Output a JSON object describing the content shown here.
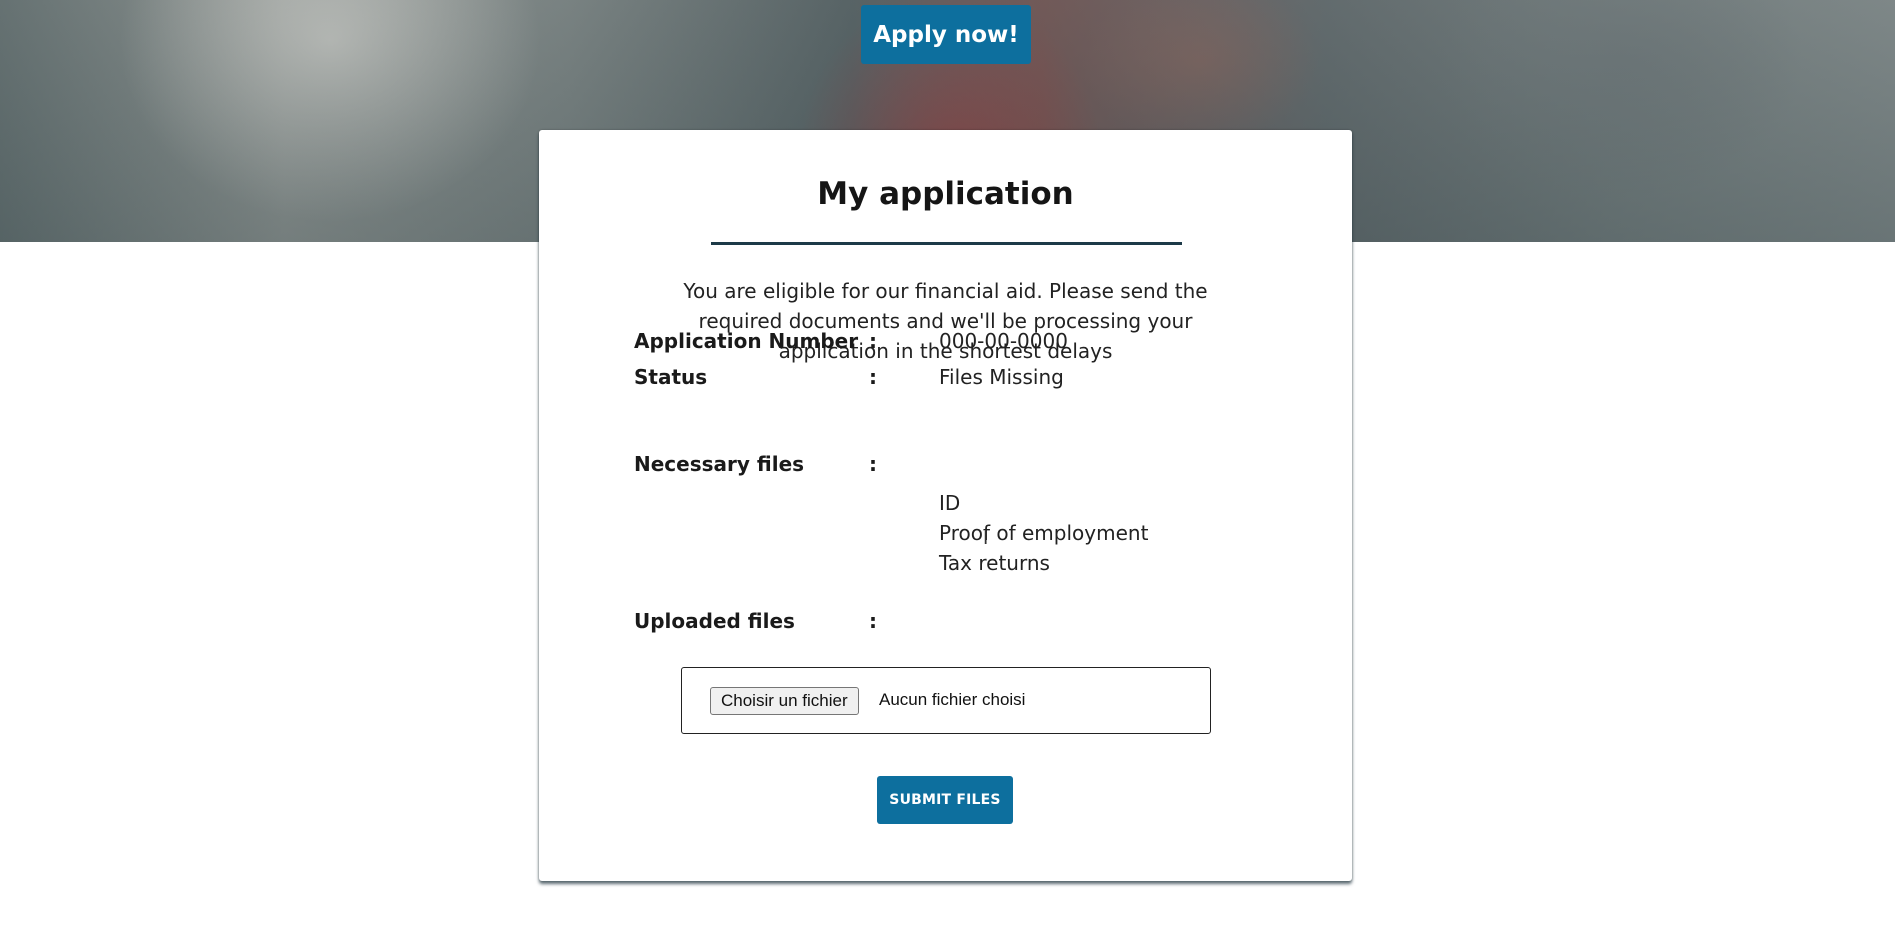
{
  "header": {
    "apply_label": "Apply now!"
  },
  "application": {
    "title": "My application",
    "intro": "You are eligible for our financial aid. Please send the required documents and we'll be processing your application in the shortest delays",
    "colon": ":",
    "fields": {
      "application_number": {
        "label": "Application Number",
        "value": "000-00-0000"
      },
      "status": {
        "label": "Status",
        "value": "Files Missing"
      },
      "necessary_files": {
        "label": "Necessary files",
        "values": [
          "ID",
          "Proof of employment",
          "Tax returns"
        ]
      },
      "uploaded_files": {
        "label": "Uploaded files"
      }
    },
    "upload": {
      "choose_label": "Choisir un fichier",
      "status_text": "Aucun fichier choisi"
    },
    "submit_label": "SUBMIT FILES"
  },
  "colors": {
    "accent": "#0d6f9e",
    "rule": "#1d3a48",
    "card": "#ffffff"
  },
  "icons": {
    "cursor": "text-cursor-icon"
  }
}
